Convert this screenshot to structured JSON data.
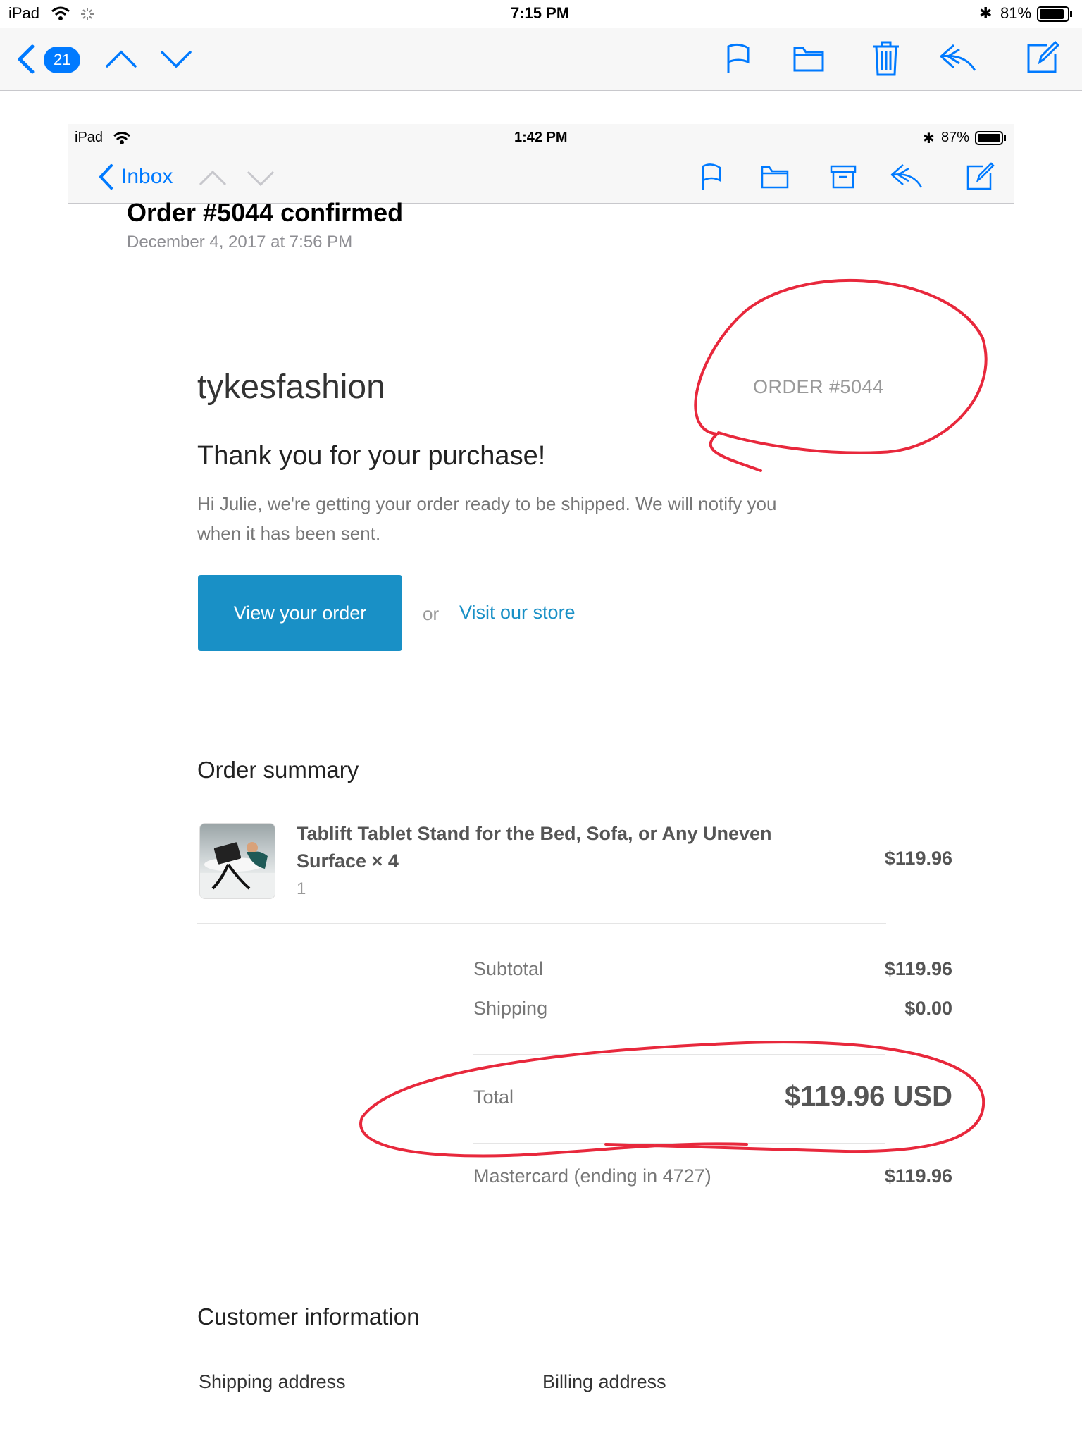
{
  "outer": {
    "status": {
      "device": "iPad",
      "time": "7:15 PM",
      "battery": "81%"
    },
    "toolbar": {
      "count": "21"
    }
  },
  "inner": {
    "status": {
      "device": "iPad",
      "time": "1:42 PM",
      "battery": "87%"
    },
    "toolbar": {
      "back_label": "Inbox"
    }
  },
  "email": {
    "subject": "Order #5044 confirmed",
    "date": "December 4, 2017 at 7:56 PM",
    "shop_name": "tykesfashion",
    "order_number": "ORDER #5044",
    "heading": "Thank you for your purchase!",
    "message_line1": "Hi Julie, we're getting your order ready to be shipped. We will notify you",
    "message_line2": "when it has been sent.",
    "view_order_label": "View your order",
    "or_label": "or",
    "visit_store_label": "Visit our store",
    "summary_title": "Order summary",
    "item": {
      "title_line1": "Tablift Tablet Stand for the Bed, Sofa, or Any Uneven",
      "title_line2": "Surface × 4",
      "quantity": "1",
      "price": "$119.96"
    },
    "totals": {
      "subtotal_label": "Subtotal",
      "subtotal": "$119.96",
      "shipping_label": "Shipping",
      "shipping": "$0.00",
      "total_label": "Total",
      "total": "$119.96 USD",
      "payment_label": "Mastercard (ending in 4727)",
      "payment": "$119.96"
    },
    "customer_title": "Customer information",
    "shipping_address_label": "Shipping address",
    "billing_address_label": "Billing address"
  },
  "colors": {
    "ios_blue": "#007aff",
    "shop_accent": "#1990c6",
    "annotation": "#e8283c"
  }
}
